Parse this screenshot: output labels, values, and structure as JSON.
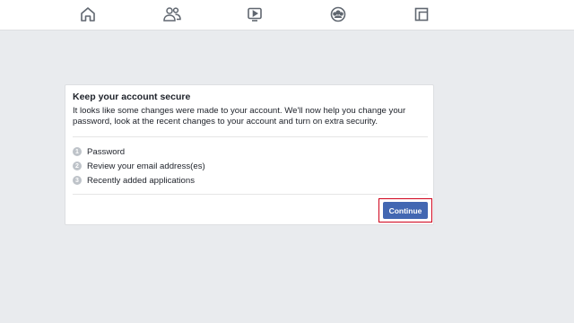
{
  "topbar": {
    "icons": [
      {
        "name": "home-icon"
      },
      {
        "name": "friends-icon"
      },
      {
        "name": "watch-icon"
      },
      {
        "name": "groups-icon"
      },
      {
        "name": "gaming-icon"
      }
    ],
    "icon_color": "#606770"
  },
  "card": {
    "title": "Keep your account secure",
    "description": "It looks like some changes were made to your account. We'll now help you change your password, look at the recent changes to your account and turn on extra security.",
    "steps": [
      {
        "number": "1",
        "label": "Password"
      },
      {
        "number": "2",
        "label": "Review your email address(es)"
      },
      {
        "number": "3",
        "label": "Recently added applications"
      }
    ],
    "continue_label": "Continue"
  },
  "colors": {
    "page_background": "#e9ebee",
    "button": "#4267b2",
    "highlight": "#d0021b",
    "step_badge": "#bec3c9"
  }
}
